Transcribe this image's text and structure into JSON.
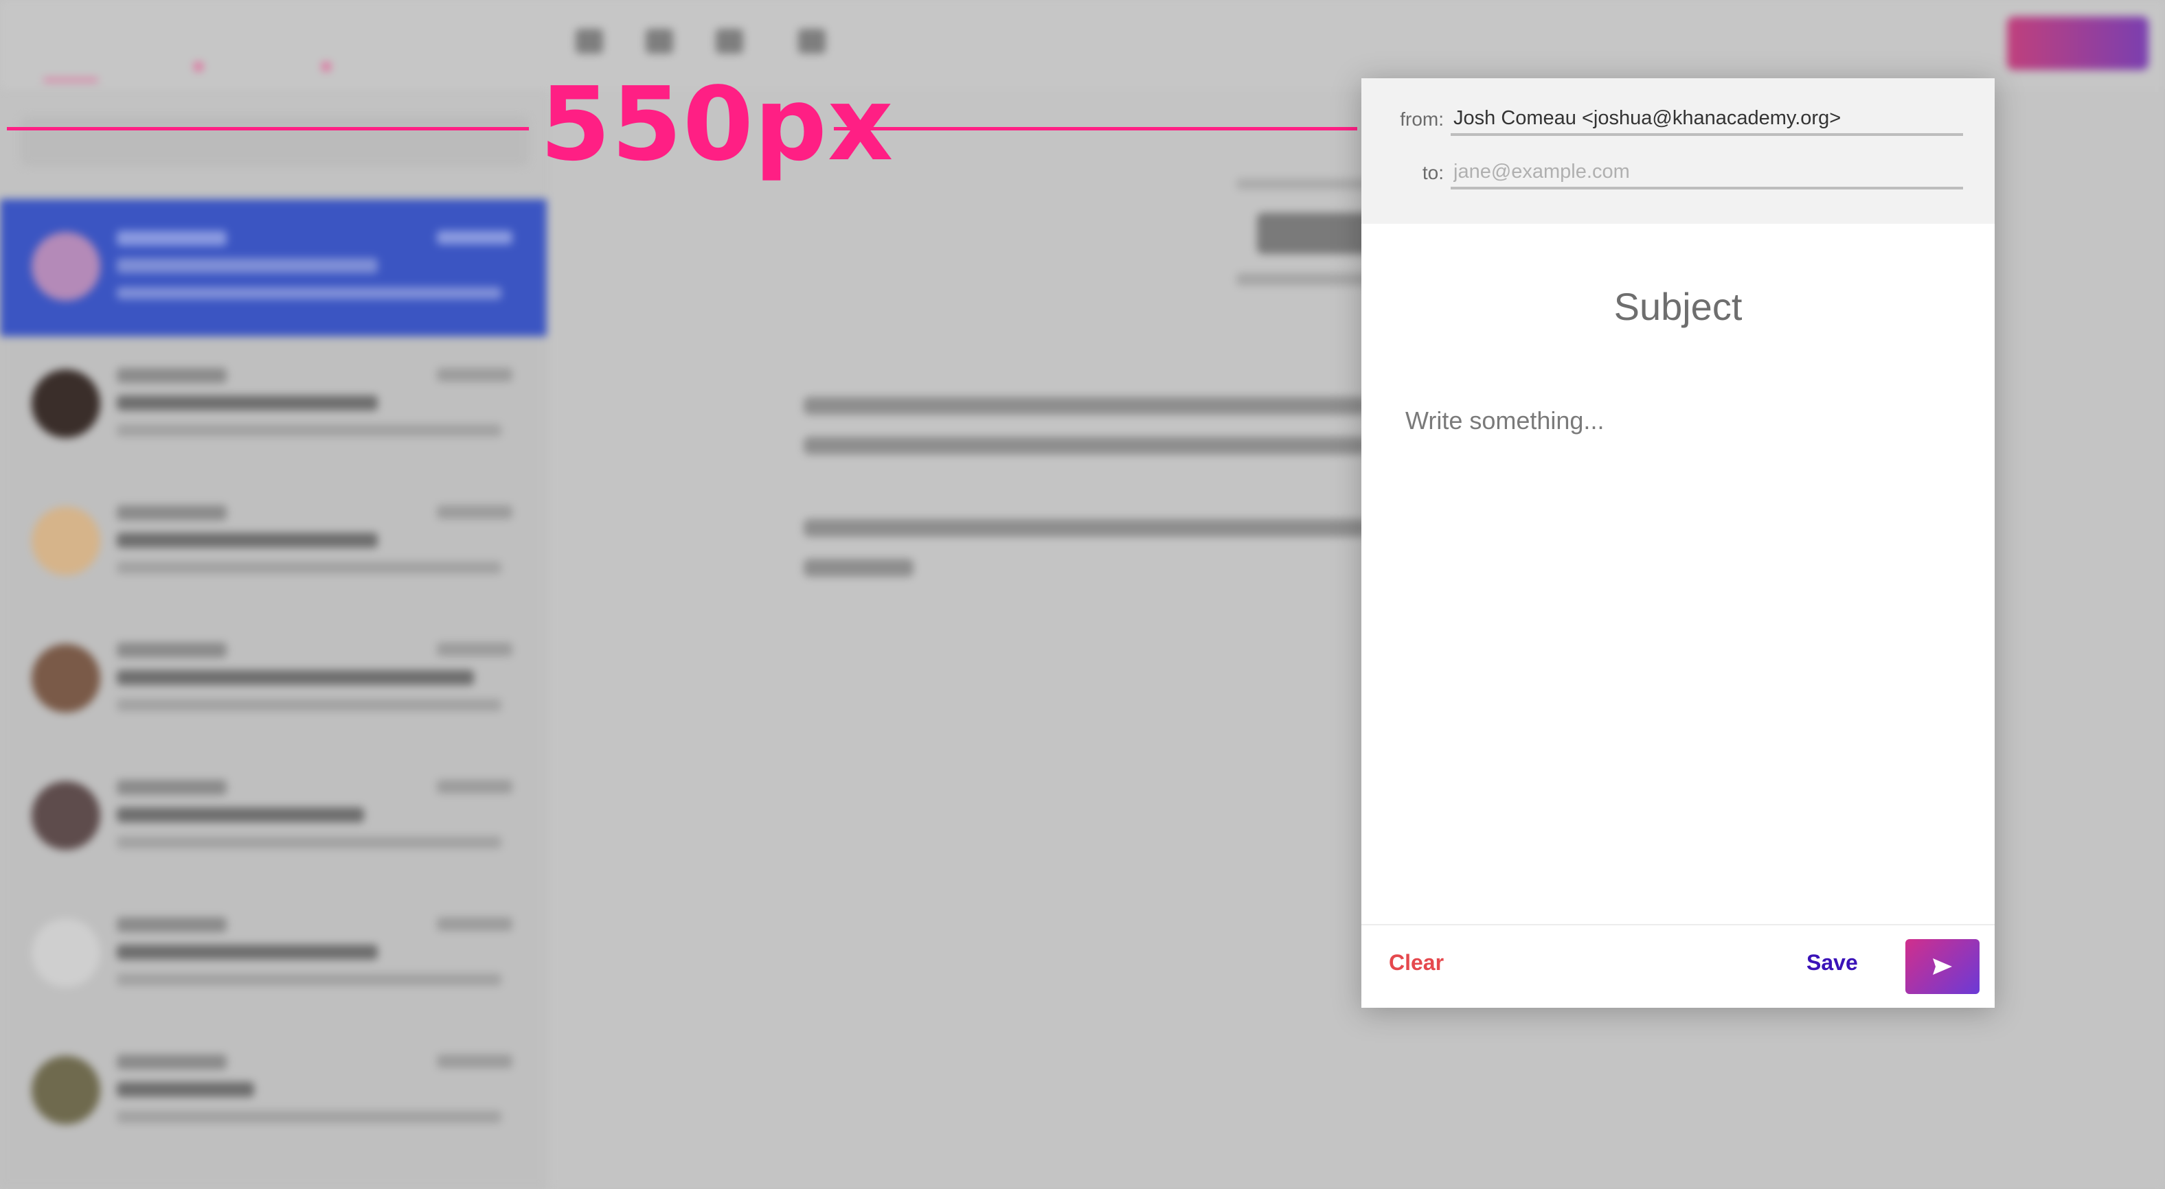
{
  "annotation": {
    "label": "550px"
  },
  "compose": {
    "from_label": "from:",
    "from_value": "Josh Comeau <joshua@khanacademy.org>",
    "to_label": "to:",
    "to_placeholder": "jane@example.com",
    "subject": "Subject",
    "body_placeholder": "Write something...",
    "clear_label": "Clear",
    "save_label": "Save",
    "send_icon": "send-icon"
  },
  "colors": {
    "annotation": "#ff1f84",
    "clear": "#e5484d",
    "save": "#3a12b8",
    "send_gradient": [
      "#d12f8c",
      "#6b3ad6"
    ],
    "active_row": "#3b55c2"
  }
}
